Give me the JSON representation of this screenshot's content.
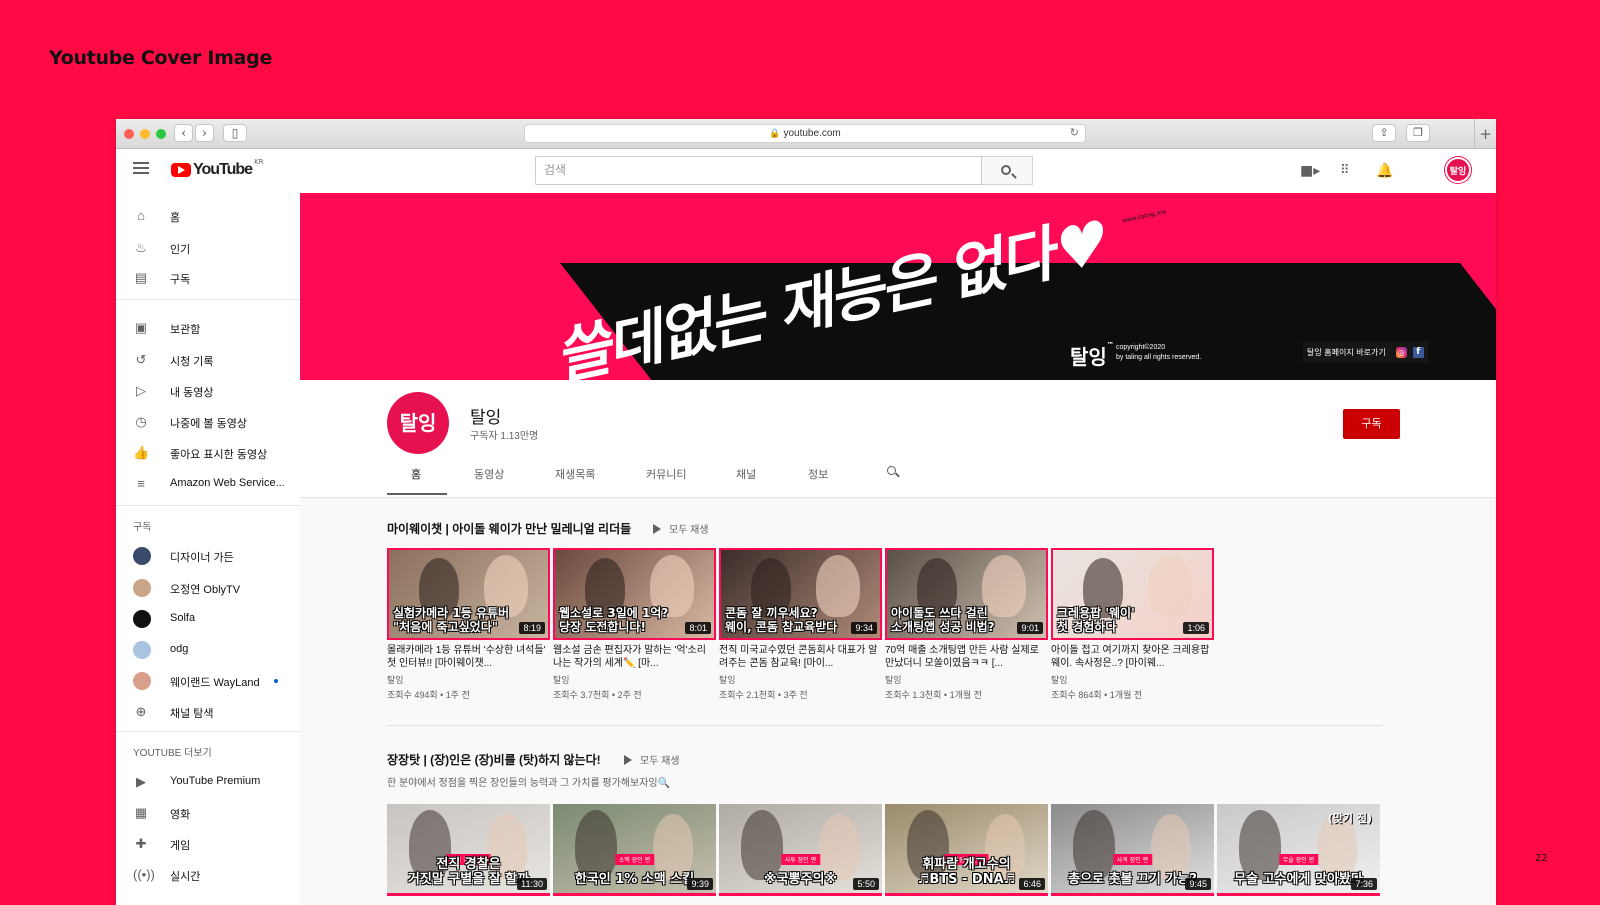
{
  "deck": {
    "title": "Youtube Cover Image",
    "page_number": "22"
  },
  "browser": {
    "url": "youtube.com"
  },
  "header": {
    "logo": "YouTube",
    "region": "KR",
    "search_placeholder": "검색",
    "avatar_text": "탈잉"
  },
  "sidebar": {
    "main": [
      {
        "label": "홈",
        "icon": "home-icon"
      },
      {
        "label": "인기",
        "icon": "fire-icon"
      },
      {
        "label": "구독",
        "icon": "subscriptions-icon"
      }
    ],
    "library": [
      {
        "label": "보관함",
        "icon": "library-icon"
      },
      {
        "label": "시청 기록",
        "icon": "history-icon"
      },
      {
        "label": "내 동영상",
        "icon": "my-videos-icon"
      },
      {
        "label": "나중에 볼 동영상",
        "icon": "watch-later-icon"
      },
      {
        "label": "좋아요 표시한 동영상",
        "icon": "thumbs-up-icon"
      },
      {
        "label": "Amazon Web Service...",
        "icon": "playlist-icon"
      }
    ],
    "subscriptions_heading": "구독",
    "subscriptions": [
      {
        "label": "디자이너 가든",
        "color": "#3a4a6b"
      },
      {
        "label": "오정연 OblyTV",
        "color": "#c9a58a"
      },
      {
        "label": "Solfa",
        "color": "#111111"
      },
      {
        "label": "odg",
        "color": "#a8c4e0"
      },
      {
        "label": "웨이랜드 WayLand",
        "color": "#d8a08a"
      },
      {
        "label": "채널 탐색",
        "color": "#606060"
      }
    ],
    "more_heading": "YOUTUBE 더보기",
    "more": [
      {
        "label": "YouTube Premium",
        "icon": "youtube-premium-icon"
      },
      {
        "label": "영화",
        "icon": "film-icon"
      },
      {
        "label": "게임",
        "icon": "gaming-icon"
      },
      {
        "label": "실시간",
        "icon": "live-icon"
      }
    ]
  },
  "banner": {
    "headline": "쓸데없는 재능은 없다♥",
    "url_text": "www.taling.me",
    "brand": "탈잉",
    "brand_mark": "™",
    "copyright_line1": "copyright©2020",
    "copyright_line2": "by taling all rights reserved.",
    "homepage_link": "탈잉 홈페이지 바로가기",
    "instagram": "◎",
    "facebook": "f"
  },
  "channel": {
    "name": "탈잉",
    "subscribers": "구독자 1.13만명",
    "avatar_text": "탈잉",
    "subscribe_label": "구독",
    "tabs": [
      "홈",
      "동영상",
      "재생목록",
      "커뮤니티",
      "채널",
      "정보"
    ]
  },
  "shelf1": {
    "title": "마이웨이챗 | 아이돌 웨이가 만난 밀레니얼 리더들",
    "play_all": "모두 재생",
    "videos": [
      {
        "caption1": "실험카메라 1등 유튜버",
        "caption2": "\"처음에 죽고싶었다\"",
        "duration": "8:19",
        "title": "몰래카메라 1등 유튜버 '수상한 녀석들' 첫 인터뷰!! [마이웨이챗...",
        "channel": "탈잉",
        "meta": "조회수 494회 • 1주 전",
        "bg1": "#8a6f5c",
        "bg2": "#c8b4a0"
      },
      {
        "caption1": "웹소설로 3일에 1억?",
        "caption2": "당장 도전합니다!",
        "duration": "8:01",
        "title": "웹소설 금손 편집자가 말하는 '억'소리 나는 작가의 세계✏️ [마...",
        "channel": "탈잉",
        "meta": "조회수 3.7천회 • 2주 전",
        "bg1": "#6b4a3e",
        "bg2": "#d9b8a4"
      },
      {
        "caption1": "콘돔 잘 끼우세요?",
        "caption2": "웨이, 콘돔 참교육받다",
        "duration": "9:34",
        "title": "전직 미국교수였던 콘돔회사 대표가 알려주는 콘돔 참교육! [마이...",
        "channel": "탈잉",
        "meta": "조회수 2.1천회 • 3주 전",
        "bg1": "#3b2d2a",
        "bg2": "#b08a78"
      },
      {
        "caption1": "아이돌도 쓰다 걸린",
        "caption2": "소개팅앱 성공 비법?",
        "duration": "9:01",
        "title": "70억 매출 소개팅앱 만든 사람 실제로 만났더니 모쏠이였음ㅋㅋ [...",
        "channel": "탈잉",
        "meta": "조회수 1.3천회 • 1개월 전",
        "bg1": "#5a5048",
        "bg2": "#d0c0b0"
      },
      {
        "caption1": "크레용팝 '웨이'",
        "caption2": "첫 경험하다",
        "duration": "1:06",
        "title": "아이돌 접고 여기까지 찾아온 크레용팝 웨이. 속사정은..? [마이웨...",
        "channel": "탈잉",
        "meta": "조회수 864회 • 1개월 전",
        "bg1": "#e8e4e0",
        "bg2": "#f4d0c8"
      }
    ]
  },
  "shelf2": {
    "title": "장장탓 | (장)인은 (장)비를 (탓)하지 않는다!",
    "play_all": "모두 재생",
    "subtitle": "한 분야에서 정점을 찍은 장인들의 능력과 그 가치를 평가해보자잉🔍",
    "videos": [
      {
        "caption1": "전직 경찰은",
        "caption2": "거짓말 구별을 잘 할까",
        "duration": "11:30",
        "tag": "전직 경찰 장인",
        "corner": "",
        "bg1": "#c8c4c0",
        "bg2": "#e8e4e0"
      },
      {
        "caption1": "",
        "caption2": "한국인 1% 소맥 스킬",
        "duration": "9:39",
        "tag": "소맥 장인 편",
        "corner": "",
        "bg1": "#7a8a70",
        "bg2": "#c8c0b0"
      },
      {
        "caption1": "",
        "caption2": "※국뽕주의※",
        "duration": "5:50",
        "tag": "사투 장인 편",
        "corner": "",
        "bg1": "#b0aaa4",
        "bg2": "#e6e0da"
      },
      {
        "caption1": "휘파람 개고수의",
        "caption2": "♬BTS - DNA♬",
        "duration": "6:46",
        "tag": "휘파람 장인 편",
        "corner": "",
        "bg1": "#9a8a6a",
        "bg2": "#e0d8c8"
      },
      {
        "caption1": "",
        "caption2": "총으로 촛불 끄기 가능?",
        "duration": "9:45",
        "tag": "사격 장인 편",
        "corner": "",
        "bg1": "#8a8a8a",
        "bg2": "#e0e0e0"
      },
      {
        "caption1": "",
        "caption2": "무술 고수에게 맞아봤다",
        "duration": "7:36",
        "tag": "무술 장인 편",
        "corner": "(맞기 전)",
        "bg1": "#c8c8c8",
        "bg2": "#f0f0f0"
      }
    ]
  }
}
